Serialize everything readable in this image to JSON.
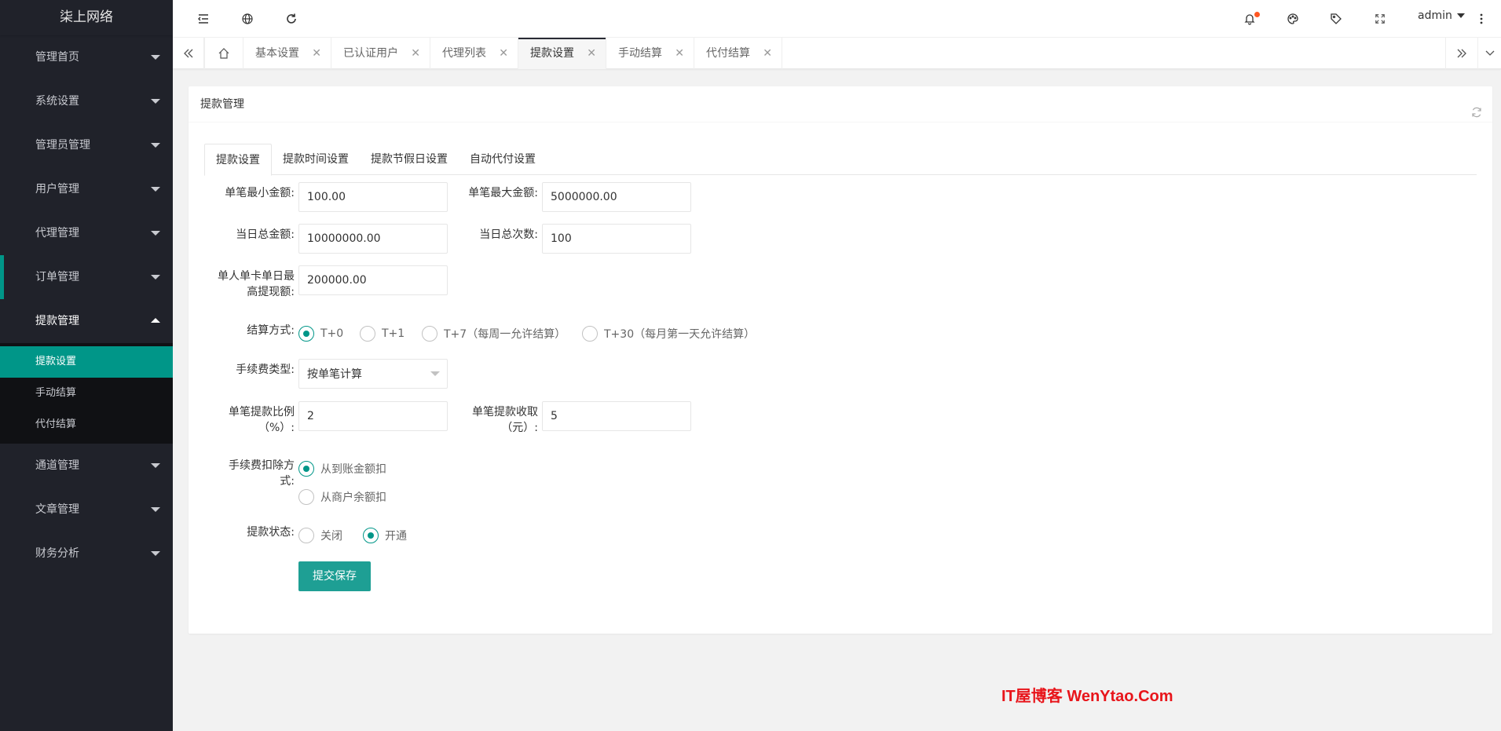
{
  "app": {
    "title": "柒上网络"
  },
  "sidebar": {
    "menu": [
      {
        "label": "管理首页"
      },
      {
        "label": "系统设置"
      },
      {
        "label": "管理员管理"
      },
      {
        "label": "用户管理"
      },
      {
        "label": "代理管理"
      },
      {
        "label": "订单管理"
      },
      {
        "label": "提款管理"
      },
      {
        "label": "通道管理"
      },
      {
        "label": "文章管理"
      },
      {
        "label": "财务分析"
      }
    ],
    "submenu": [
      {
        "label": "提款设置"
      },
      {
        "label": "手动结算"
      },
      {
        "label": "代付结算"
      }
    ]
  },
  "header": {
    "icons": [
      "menu-fold-icon",
      "globe-icon",
      "refresh-icon",
      "bell-icon",
      "theme-icon",
      "tag-icon",
      "fullscreen-icon",
      "more-icon"
    ],
    "user": "admin"
  },
  "tabs": [
    {
      "label": "基本设置"
    },
    {
      "label": "已认证用户"
    },
    {
      "label": "代理列表"
    },
    {
      "label": "提款设置"
    },
    {
      "label": "手动结算"
    },
    {
      "label": "代付结算"
    }
  ],
  "card": {
    "title": "提款管理"
  },
  "form_tabs": [
    {
      "label": "提款设置"
    },
    {
      "label": "提款时间设置"
    },
    {
      "label": "提款节假日设置"
    },
    {
      "label": "自动代付设置"
    }
  ],
  "form": {
    "min_amount": {
      "label": "单笔最小金额:",
      "value": "100.00"
    },
    "max_amount": {
      "label": "单笔最大金额:",
      "value": "5000000.00"
    },
    "daily_total": {
      "label": "当日总金额:",
      "value": "10000000.00"
    },
    "daily_count": {
      "label": "当日总次数:",
      "value": "100"
    },
    "card_daily_max": {
      "label_1": "单人单卡单日最",
      "label_2": "高提现额:",
      "value": "200000.00"
    },
    "settlement": {
      "label": "结算方式:",
      "options": [
        "T+0",
        "T+1",
        "T+7（每周一允许结算）",
        "T+30（每月第一天允许结算）"
      ],
      "selected": "T+0"
    },
    "fee_type": {
      "label": "手续费类型:",
      "value": "按单笔计算"
    },
    "fee_rate": {
      "label_1": "单笔提款比例",
      "label_2": "（%）:",
      "value": "2"
    },
    "fee_fixed": {
      "label_1": "单笔提款收取",
      "label_2": "（元）:",
      "value": "5"
    },
    "deduct": {
      "label_1": "手续费扣除方",
      "label_2": "式:",
      "options": [
        "从到账金额扣",
        "从商户余额扣"
      ],
      "selected": "从到账金额扣"
    },
    "status": {
      "label": "提款状态:",
      "options": [
        "关闭",
        "开通"
      ],
      "selected": "开通"
    },
    "submit": "提交保存"
  },
  "watermark": "IT屋博客  WenYtao.Com"
}
